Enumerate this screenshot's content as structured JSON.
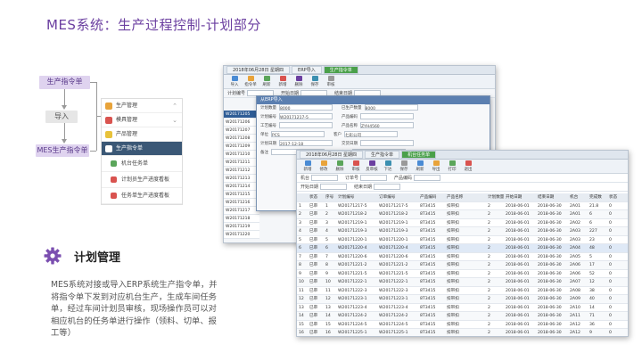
{
  "slide": {
    "title": "MES系统：生产过程控制-计划部分"
  },
  "flow": {
    "top": "生产指令单",
    "mid": "导入",
    "bottom": "MES生产指令单"
  },
  "side_menu": {
    "items": [
      {
        "label": "生产管理",
        "arrow": "⌃",
        "color": "#e8a33a"
      },
      {
        "label": "模具管理",
        "arrow": "⌄",
        "color": "#d9534f"
      },
      {
        "label": "产品管理",
        "arrow": "",
        "color": "#e8c23a"
      },
      {
        "label": "生产指令单",
        "arrow": "",
        "color": "#ffffff",
        "active": true
      },
      {
        "label": "机台任务单",
        "arrow": "",
        "color": "#5aa55a",
        "sub": true
      },
      {
        "label": "计划员生产进度看板",
        "arrow": "",
        "color": "#d9534f",
        "sub": true
      },
      {
        "label": "任务单生产进度看板",
        "arrow": "",
        "color": "#d9534f",
        "sub": true
      }
    ]
  },
  "plan": {
    "title": "计划管理",
    "description": "MES系统对接或导入ERP系统生产指令单，并将指令单下发到对应机台生产，生成车间任务单，经过车间计划员审核，现场操作员可以对相应机台的任务单进行操作（领料、切单、报工等）"
  },
  "window1": {
    "tabs": [
      "2018年06月28日 星期四",
      "ERP导入",
      "生产指令单"
    ],
    "toolbar": [
      "导入",
      "指令单",
      "刷新",
      "新增",
      "删除",
      "保存",
      "审核"
    ],
    "filter": [
      "计划编号",
      "开始日期",
      "结束日期"
    ],
    "rows": [
      "W20171205",
      "W20171206",
      "W20171207",
      "W20171208",
      "W20171209",
      "W20171210",
      "W20171211",
      "W20171212",
      "W20171213",
      "W20171214",
      "W20171215",
      "W20171216",
      "W20171217",
      "W20171218",
      "W20171219",
      "W20171220"
    ]
  },
  "dialog": {
    "title": "从ERP导入",
    "fields": [
      [
        "计划数量",
        "8000",
        "已生产数量",
        "8000"
      ],
      [
        "计划编号",
        "W20171217-5",
        "产品编码",
        ""
      ],
      [
        "工艺编号",
        "",
        "产品名称",
        "ZYH4560"
      ],
      [
        "单位",
        "PCS",
        "客户",
        "七彩公司"
      ],
      [
        "计划日期",
        "2017-12-18",
        "交货日期",
        ""
      ],
      [
        "备注",
        "",
        "生产车间",
        ""
      ]
    ]
  },
  "window2": {
    "tabs": [
      "2018年06月28日 星期四",
      "生产指令单",
      "机台任务单"
    ],
    "toolbar": [
      "新增",
      "修改",
      "删除",
      "审核",
      "反审核",
      "下达",
      "保存",
      "刷新",
      "导出",
      "打印",
      "退出"
    ],
    "filter": [
      "机台",
      "订单号",
      "产品编码",
      "开始日期",
      "结束日期"
    ],
    "headers": [
      "",
      "状态",
      "序号",
      "计划编号",
      "订单编号",
      "产品编码",
      "产品名称",
      "计划数量",
      "开始日期",
      "结束日期",
      "机台",
      "完成数",
      "状态"
    ],
    "rows": [
      [
        "1",
        "已审",
        "1",
        "W20171217-5",
        "W20171217-5",
        "8T3415",
        "扣带扣",
        "2",
        "2018-06-01",
        "2018-06-30",
        "2A01",
        "21.8",
        "0"
      ],
      [
        "2",
        "已审",
        "2",
        "W20171218-2",
        "W20171218-2",
        "8T3415",
        "扣带扣",
        "2",
        "2018-06-01",
        "2018-06-30",
        "2A01",
        "6",
        "0"
      ],
      [
        "3",
        "已审",
        "3",
        "W20171219-1",
        "W20171219-1",
        "8T3415",
        "扣带扣",
        "2",
        "2018-06-01",
        "2018-06-30",
        "2A02",
        "6",
        "0"
      ],
      [
        "4",
        "已审",
        "4",
        "W20171219-3",
        "W20171219-3",
        "8T3415",
        "扣带扣",
        "2",
        "2018-06-01",
        "2018-06-30",
        "2A03",
        "227",
        "0"
      ],
      [
        "5",
        "已审",
        "5",
        "W20171220-1",
        "W20171220-1",
        "8T3415",
        "扣带扣",
        "2",
        "2018-06-01",
        "2018-06-30",
        "2A03",
        "23",
        "0"
      ],
      [
        "6",
        "已审",
        "6",
        "W20171220-4",
        "W20171220-4",
        "8T3415",
        "扣带扣",
        "2",
        "2018-06-01",
        "2018-06-30",
        "2A04",
        "48",
        "0"
      ],
      [
        "7",
        "已审",
        "7",
        "W20171220-6",
        "W20171220-6",
        "8T3415",
        "扣带扣",
        "2",
        "2018-06-01",
        "2018-06-30",
        "2A05",
        "5",
        "0"
      ],
      [
        "8",
        "已审",
        "8",
        "W20171221-2",
        "W20171221-2",
        "8T3415",
        "扣带扣",
        "2",
        "2018-06-01",
        "2018-06-30",
        "2A06",
        "17",
        "0"
      ],
      [
        "9",
        "已审",
        "9",
        "W20171221-5",
        "W20171221-5",
        "8T3415",
        "扣带扣",
        "2",
        "2018-06-01",
        "2018-06-30",
        "2A06",
        "52",
        "0"
      ],
      [
        "10",
        "已审",
        "10",
        "W20171222-1",
        "W20171222-1",
        "8T3415",
        "扣带扣",
        "2",
        "2018-06-01",
        "2018-06-30",
        "2A07",
        "12",
        "0"
      ],
      [
        "11",
        "已审",
        "11",
        "W20171222-3",
        "W20171222-3",
        "8T3415",
        "扣带扣",
        "2",
        "2018-06-01",
        "2018-06-30",
        "2A08",
        "38",
        "0"
      ],
      [
        "12",
        "已审",
        "12",
        "W20171223-1",
        "W20171223-1",
        "8T3415",
        "扣带扣",
        "2",
        "2018-06-01",
        "2018-06-30",
        "2A09",
        "40",
        "0"
      ],
      [
        "13",
        "已审",
        "13",
        "W20171223-4",
        "W20171223-4",
        "8T3415",
        "扣带扣",
        "2",
        "2018-06-01",
        "2018-06-30",
        "2A10",
        "14",
        "0"
      ],
      [
        "14",
        "已审",
        "14",
        "W20171224-2",
        "W20171224-2",
        "8T3415",
        "扣带扣",
        "2",
        "2018-06-01",
        "2018-06-30",
        "2A11",
        "71",
        "0"
      ],
      [
        "15",
        "已审",
        "15",
        "W20171224-5",
        "W20171224-5",
        "8T3415",
        "扣带扣",
        "2",
        "2018-06-01",
        "2018-06-30",
        "2A12",
        "36",
        "0"
      ],
      [
        "16",
        "已审",
        "16",
        "W20171225-1",
        "W20171225-1",
        "8T3415",
        "扣带扣",
        "2",
        "2018-06-01",
        "2018-06-30",
        "2A12",
        "9",
        "0"
      ],
      [
        "17",
        "已审",
        "17",
        "W20171225-3",
        "W20171225-3",
        "8T3415",
        "扣带扣",
        "2",
        "2018-06-01",
        "2018-06-30",
        "2A13",
        "22",
        "0"
      ]
    ]
  },
  "colors": {
    "accent": "#6b3fa0",
    "selected": "#2f5d96",
    "menu_active": "#3b5876"
  }
}
